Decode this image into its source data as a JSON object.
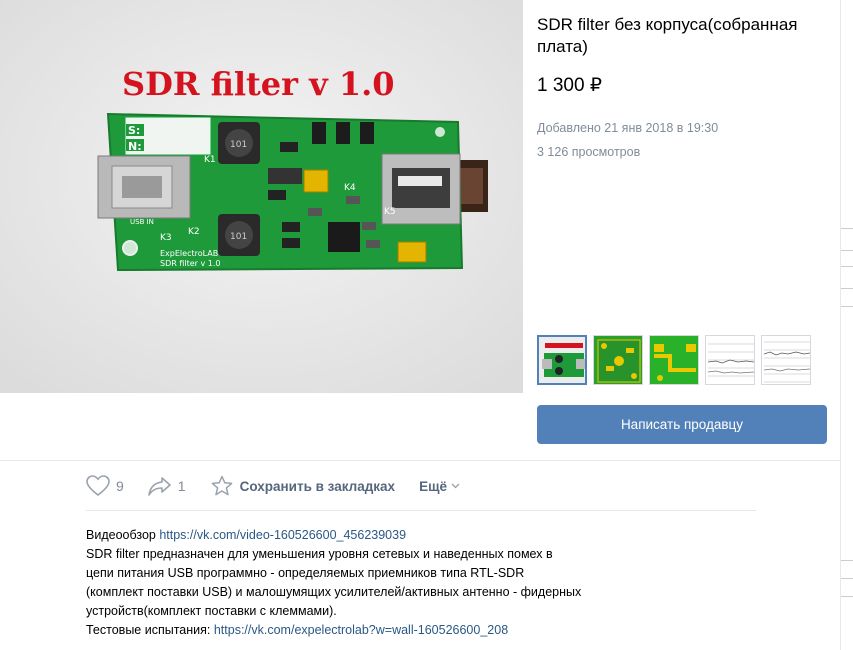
{
  "listing": {
    "title": "SDR filter без корпуса(собранная плата)",
    "price": "1 300 ₽",
    "added": "Добавлено 21 янв 2018 в 19:30",
    "views": "3 126 просмотров",
    "contact_label": "Написать продавцу"
  },
  "photo": {
    "board_title": "SDR filter v 1.0",
    "silkscreen": {
      "s_label": "S:",
      "n_label": "N:",
      "usb_in": "USB IN",
      "k1": "K1",
      "k2": "K2",
      "k3": "K3",
      "k4": "K4",
      "k5": "K5",
      "brand": "ExpElectroLAB",
      "version": "SDR filter v 1.0"
    },
    "board_color": "#1e9a3a",
    "title_color": "#d4131f"
  },
  "thumbnails": [
    {
      "name": "thumb-board-photo"
    },
    {
      "name": "thumb-pcb-top"
    },
    {
      "name": "thumb-pcb-bottom"
    },
    {
      "name": "thumb-test-chart-1"
    },
    {
      "name": "thumb-test-chart-2"
    }
  ],
  "actions": {
    "likes": "9",
    "shares": "1",
    "save_label": "Сохранить в закладках",
    "more_label": "Ещё"
  },
  "description": {
    "line1_prefix": "Видеообзор ",
    "line1_link": "https://vk.com/video-160526600_456239039",
    "line2": "SDR filter предназначен для уменьшения уровня сетевых и наведенных помех в",
    "line3": "цепи питания USB программно - определяемых приемников типа RTL-SDR",
    "line4": "(комплект поставки USB) и малошумящих усилителей/активных антенно - фидерных",
    "line5": "устройств(комплект поставки с клеммами).",
    "line6_prefix": "Тестовые испытания: ",
    "line6_link": "https://vk.com/expelectrolab?w=wall-160526600_208"
  },
  "colors": {
    "accent": "#5181b8",
    "link": "#2a5885",
    "muted": "#818c99"
  }
}
